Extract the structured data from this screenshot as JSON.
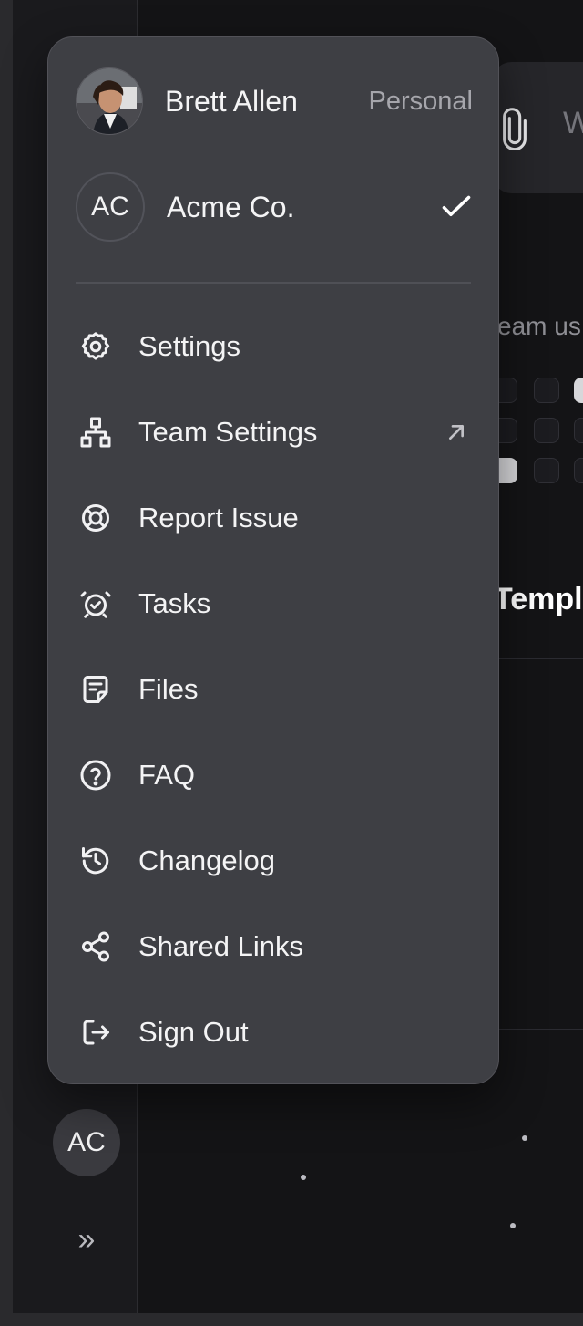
{
  "popover": {
    "accounts": [
      {
        "name": "Brett Allen",
        "type": "Personal",
        "avatar": "profile-photo"
      },
      {
        "name": "Acme Co.",
        "initials": "AC",
        "selected": true
      }
    ],
    "menu": [
      {
        "label": "Settings",
        "icon": "settings-gear-icon"
      },
      {
        "label": "Team Settings",
        "icon": "team-hierarchy-icon",
        "external_icon": "external-link-icon"
      },
      {
        "label": "Report Issue",
        "icon": "lifebuoy-icon"
      },
      {
        "label": "Tasks",
        "icon": "alarm-clock-icon"
      },
      {
        "label": "Files",
        "icon": "file-note-icon"
      },
      {
        "label": "FAQ",
        "icon": "help-circle-icon"
      },
      {
        "label": "Changelog",
        "icon": "history-icon"
      },
      {
        "label": "Shared Links",
        "icon": "share-icon"
      },
      {
        "label": "Sign Out",
        "icon": "sign-out-icon"
      }
    ]
  },
  "sidebar": {
    "user_initials": "AC",
    "expand_icon": "double-chevron-right-icon"
  },
  "background": {
    "partial_letter": "W",
    "partial_team_text": "eam us",
    "partial_heading": "Templ"
  },
  "colors": {
    "page_bg": "#141416",
    "popover_bg": "#3e3f44",
    "text_primary": "#f4f4f5",
    "text_secondary": "#a6a6ac"
  }
}
